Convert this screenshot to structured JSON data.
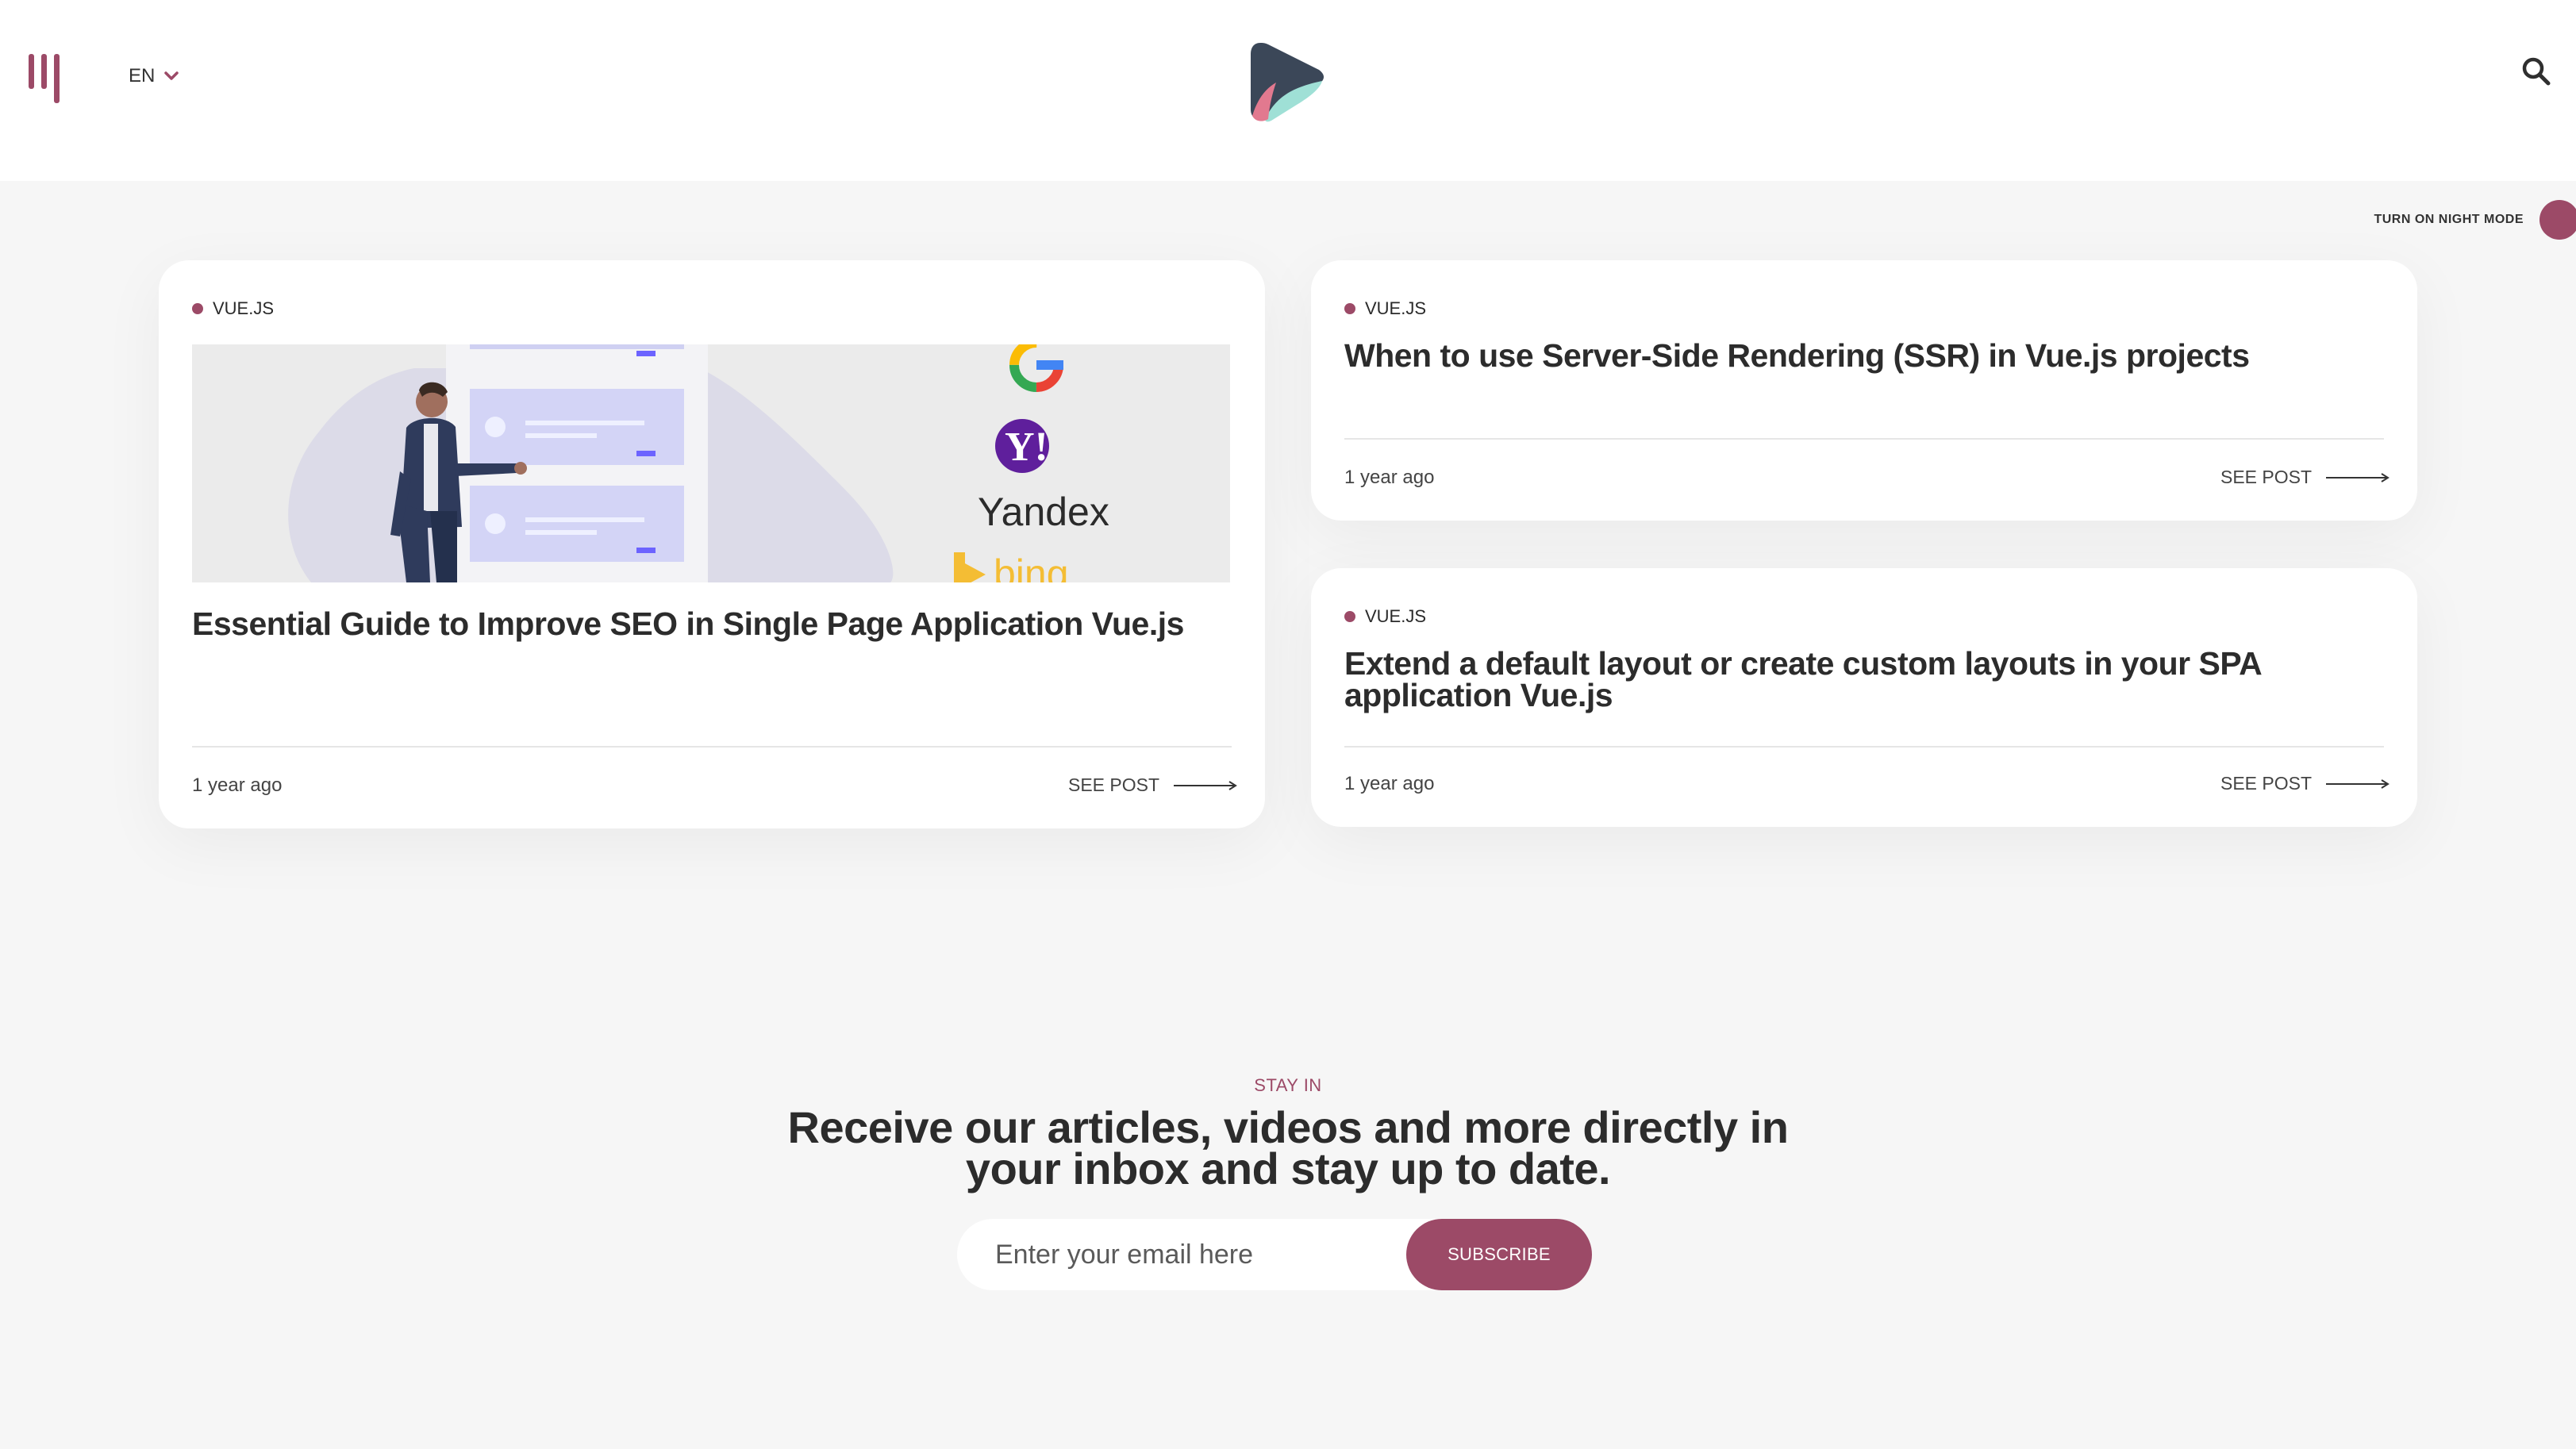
{
  "header": {
    "language": "EN",
    "icons": {
      "menu": "menu-bars-icon",
      "language_caret": "chevron-down-icon",
      "logo": "play-logo",
      "search": "search-icon"
    }
  },
  "night_mode": {
    "label": "TURN ON NIGHT MODE"
  },
  "posts": [
    {
      "tag": "VUE.JS",
      "title": "Essential Guide to Improve SEO in Single Page Application Vue.js",
      "time": "1 year ago",
      "cta": "SEE POST",
      "image_labels": {
        "yahoo": "Y!",
        "yandex": "Yandex",
        "bing": "bing"
      }
    },
    {
      "tag": "VUE.JS",
      "title": "When to use Server-Side Rendering (SSR) in Vue.js projects",
      "time": "1 year ago",
      "cta": "SEE POST"
    },
    {
      "tag": "VUE.JS",
      "title_line1": "Extend a default layout or create custom layouts in your SPA",
      "title_line2": "application Vue.js",
      "time": "1 year ago",
      "cta": "SEE POST"
    }
  ],
  "newsletter": {
    "eyebrow": "STAY IN",
    "headline_line1": "Receive our articles, videos and more directly in",
    "headline_line2": "your inbox and stay up to date.",
    "email_placeholder": "Enter your email here",
    "button_label": "SUBSCRIBE"
  },
  "colors": {
    "accent": "#9c4a67",
    "background": "#f6f6f6",
    "card": "#ffffff",
    "text": "#2c2c2c"
  }
}
